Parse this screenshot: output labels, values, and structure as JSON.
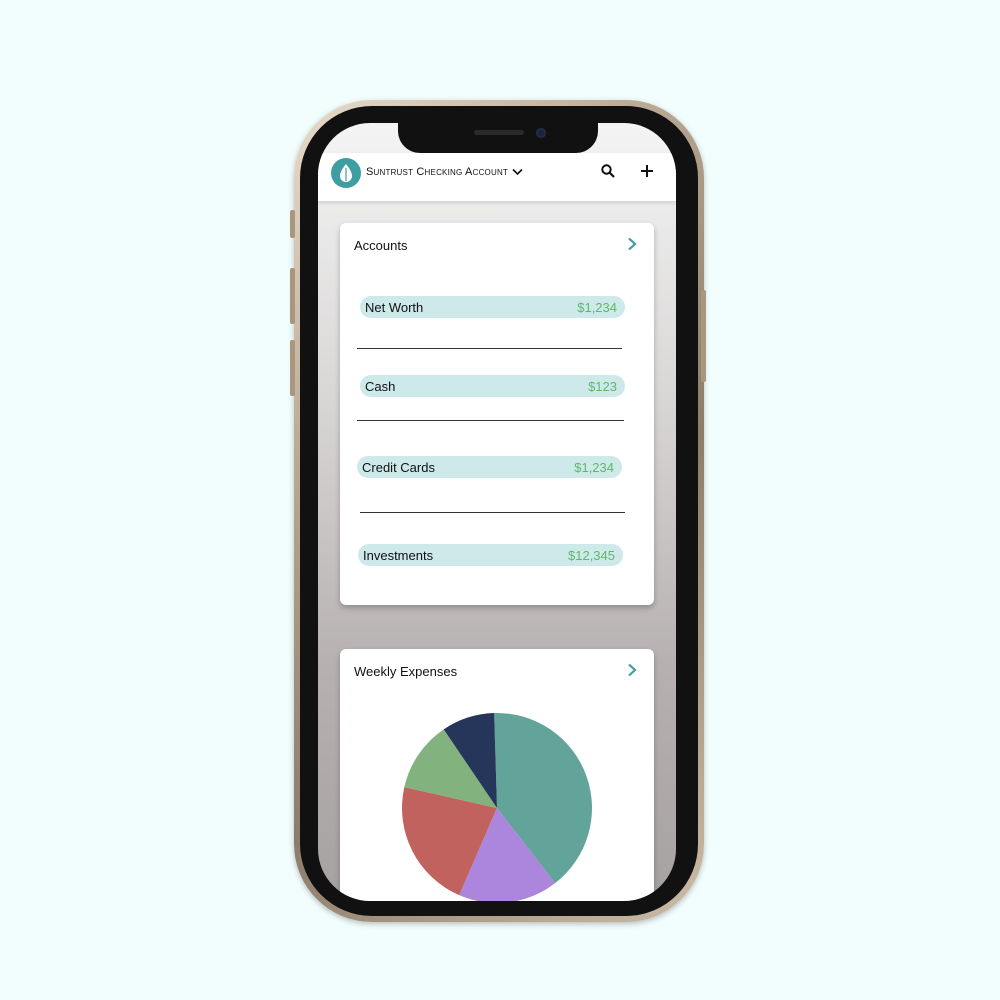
{
  "header": {
    "account_title": "Suntrust Checking Account",
    "icons": [
      "leaf-drop-icon",
      "chevron-down-icon",
      "search-icon",
      "plus-icon"
    ]
  },
  "accounts": {
    "title": "Accounts",
    "rows": [
      {
        "label": "Net Worth",
        "amount": "$1,234"
      },
      {
        "label": "Cash",
        "amount": "$123"
      },
      {
        "label": "Credit Cards",
        "amount": "$1,234"
      },
      {
        "label": "Investments",
        "amount": "$12,345"
      }
    ]
  },
  "weekly_expenses": {
    "title": "Weekly Expenses"
  },
  "chart_data": {
    "type": "pie",
    "values": [
      40,
      17,
      22,
      12,
      9
    ],
    "colors": [
      "#62a39a",
      "#ab86dc",
      "#c1625f",
      "#82b37e",
      "#26365a"
    ]
  },
  "colors": {
    "accent": "#3f9ea2",
    "row_bg": "#cde9ea",
    "amount": "#5fb86a",
    "page_bg": "#f2fdfd"
  }
}
